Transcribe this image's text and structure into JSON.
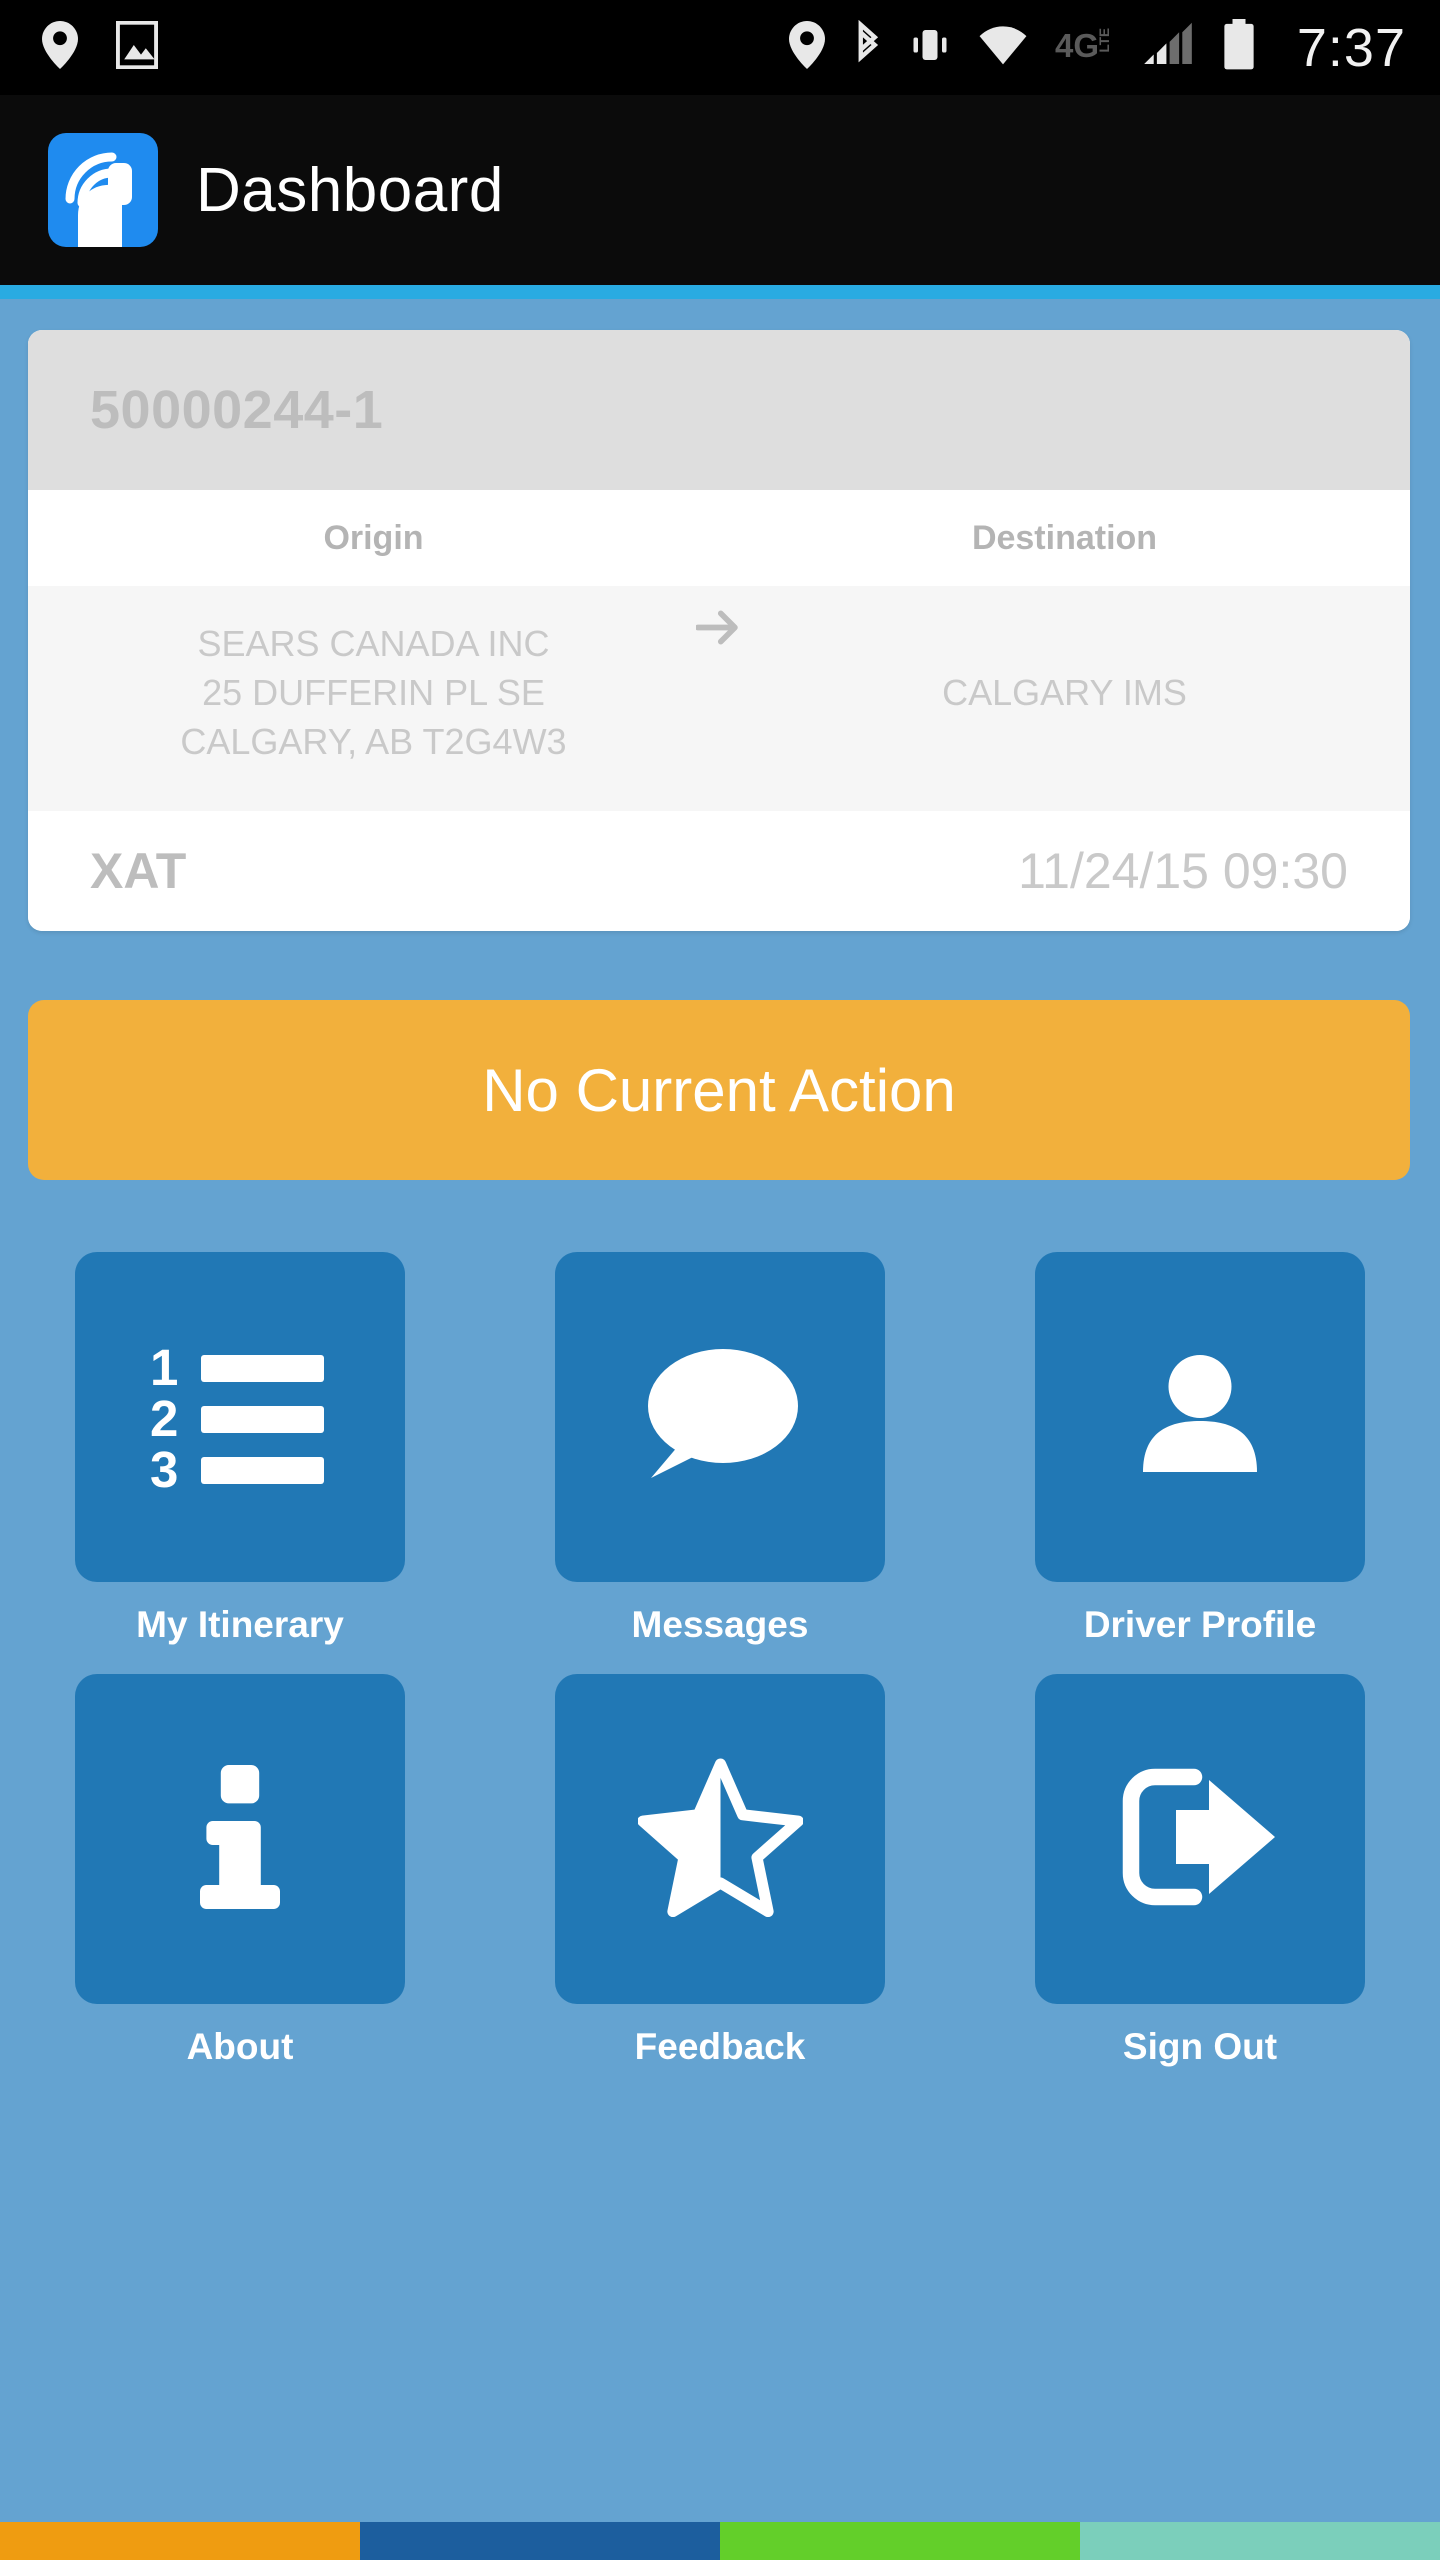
{
  "status_bar": {
    "icons_left": [
      "location-pin-icon",
      "image-icon"
    ],
    "icons_right": [
      "location-pin-icon",
      "bluetooth-icon",
      "vibrate-icon",
      "wifi-icon",
      "network-4glte-icon",
      "signal-bars-icon",
      "battery-icon"
    ],
    "network_label": "4G",
    "network_sub": "LTE",
    "clock": "7:37"
  },
  "app_bar": {
    "logo_icon": "app-logo-icon",
    "title": "Dashboard"
  },
  "trip_card": {
    "load_number": "50000244-1",
    "origin_label": "Origin",
    "destination_label": "Destination",
    "origin_line1": "SEARS CANADA INC",
    "origin_line2": "25 DUFFERIN PL SE",
    "origin_line3": "CALGARY, AB T2G4W3",
    "destination_line1": "CALGARY IMS",
    "arrow_icon": "arrow-right-icon",
    "status_code": "XAT",
    "status_datetime": "11/24/15 09:30"
  },
  "action_banner": {
    "label": "No Current Action",
    "color": "#F2B03C"
  },
  "grid": {
    "items": [
      {
        "label": "My Itinerary",
        "icon": "numbered-list-icon"
      },
      {
        "label": "Messages",
        "icon": "speech-bubble-icon"
      },
      {
        "label": "Driver Profile",
        "icon": "person-icon"
      },
      {
        "label": "About",
        "icon": "info-icon"
      },
      {
        "label": "Feedback",
        "icon": "half-star-icon"
      },
      {
        "label": "Sign Out",
        "icon": "exit-arrow-icon"
      }
    ],
    "tile_color": "#2178B5"
  },
  "bottom_bar": {
    "segments": [
      "#EF9C11",
      "#1C5E9E",
      "#63CF2A",
      "#7BCFBB"
    ]
  },
  "theme": {
    "background": "#64A3D1",
    "accent_line": "#29ABE2",
    "appbar_background": "#0B0B0B"
  }
}
